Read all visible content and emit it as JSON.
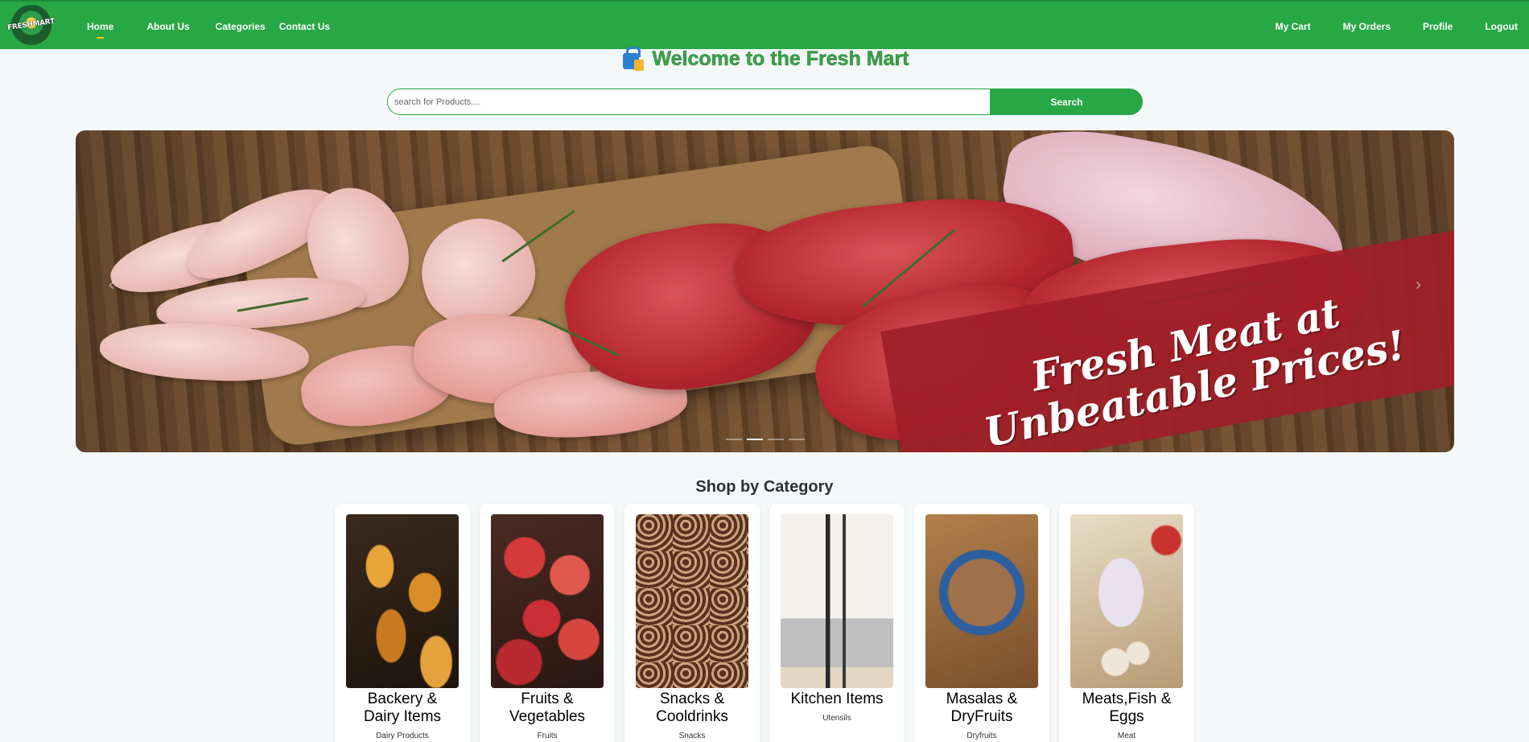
{
  "brand": {
    "logo_text": "FRESHMART"
  },
  "nav": {
    "left": [
      "Home",
      "About Us",
      "Categories",
      "Contact Us"
    ],
    "right": [
      "My Cart",
      "My Orders",
      "Profile",
      "Logout"
    ]
  },
  "welcome": {
    "title": "Welcome to the Fresh Mart"
  },
  "search": {
    "placeholder": "search for Products....",
    "button": "Search"
  },
  "carousel": {
    "caption_line1": "Fresh Meat at",
    "caption_line2": "Unbeatable Prices!",
    "prev_icon": "‹",
    "next_icon": "›",
    "slide_count": 4,
    "active_slide": 2
  },
  "categories": {
    "title": "Shop by Category",
    "items": [
      {
        "name": "Backery & Dairy Items",
        "line1": "Backery &",
        "line2": "Dairy Items",
        "sub": "Dairy Products"
      },
      {
        "name": "Fruits & Vegetables",
        "line1": "Fruits &",
        "line2": "Vegetables",
        "sub": "Fruits"
      },
      {
        "name": "Snacks & Cooldrinks",
        "line1": "Snacks &",
        "line2": "Cooldrinks",
        "sub": "Snacks"
      },
      {
        "name": "Kitchen Items",
        "line1": "Kitchen Items",
        "line2": "",
        "sub": "Utensils"
      },
      {
        "name": "Masalas & DryFruits",
        "line1": "Masalas &",
        "line2": "DryFruits",
        "sub": "Dryfruits"
      },
      {
        "name": "Meats,Fish & Eggs",
        "line1": "Meats,Fish &",
        "line2": "Eggs",
        "sub": "Meat"
      }
    ]
  },
  "colors": {
    "primary": "#28a745",
    "accent": "#ffc107"
  }
}
